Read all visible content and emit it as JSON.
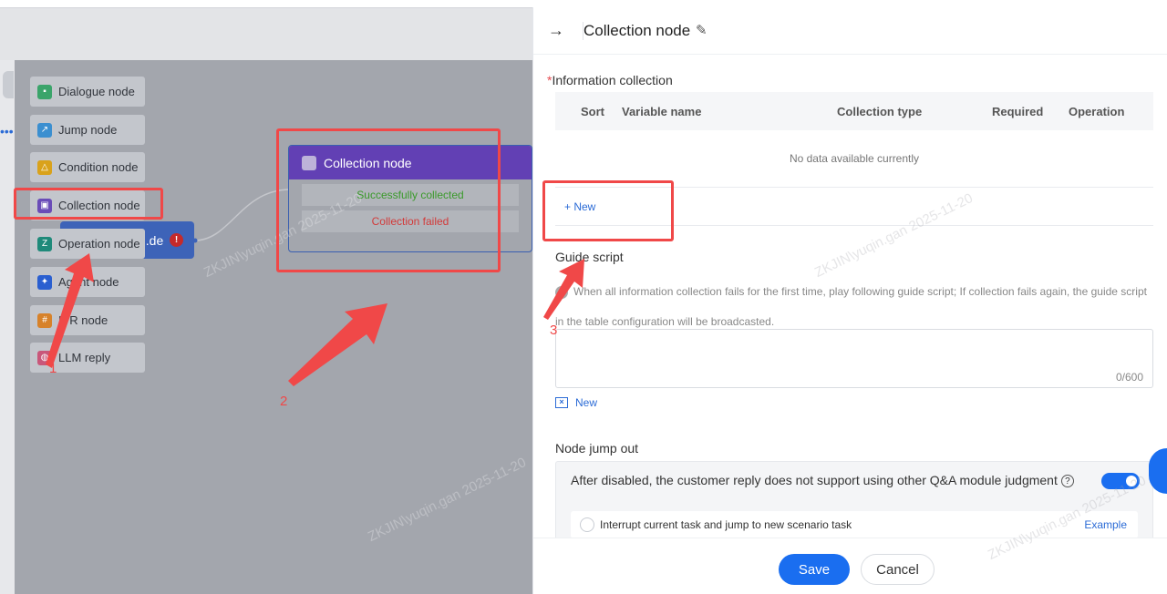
{
  "palette": {
    "items": [
      {
        "label": "Dialogue node",
        "icon": "dialogue-icon",
        "color": "#3aa46a"
      },
      {
        "label": "Jump node",
        "icon": "jump-icon",
        "color": "#3b8fd0"
      },
      {
        "label": "Condition node",
        "icon": "condition-icon",
        "color": "#d9a21b"
      },
      {
        "label": "Collection node",
        "icon": "collection-icon",
        "color": "#6a4cb8"
      },
      {
        "label": "Operation node",
        "icon": "operation-icon",
        "color": "#1f8a7a"
      },
      {
        "label": "Agent node",
        "icon": "agent-icon",
        "color": "#2a5fd0"
      },
      {
        "label": "IVR node",
        "icon": "ivr-icon",
        "color": "#d7822a"
      },
      {
        "label": "LLM reply",
        "icon": "llm-icon",
        "color": "#c9577a"
      }
    ]
  },
  "canvas": {
    "bg_node_label": "...de",
    "collection_node": {
      "title": "Collection node",
      "success": "Successfully collected",
      "failed": "Collection failed"
    },
    "watermark": "ZKJIN\\yuqin.gan  2025-11-20"
  },
  "annotations": {
    "a1": "1",
    "a2": "2",
    "a3": "3"
  },
  "panel": {
    "title": "Collection node",
    "info_collection_label": "Information collection",
    "table": {
      "columns": [
        "Sort",
        "Variable name",
        "Collection type",
        "Required",
        "Operation"
      ],
      "empty_text": "No data available currently",
      "new_label": "+ New"
    },
    "guide_script": {
      "label": "Guide script",
      "hint": "When all information collection fails for the first time, play following guide script; If collection fails again, the guide script in the table configuration will be broadcasted.",
      "counter": "0/600",
      "new_label": "New"
    },
    "jump_out": {
      "label": "Node jump out",
      "toggle_text": "After disabled, the customer reply does not support using other Q&A module judgment",
      "toggle_on": true,
      "option_text": "Interrupt current task and jump to new scenario task",
      "example_label": "Example"
    },
    "footer": {
      "save": "Save",
      "cancel": "Cancel"
    }
  },
  "colors": {
    "accent": "#1a6ef0",
    "annotation": "#f04848",
    "node_purple": "#6240b4"
  }
}
